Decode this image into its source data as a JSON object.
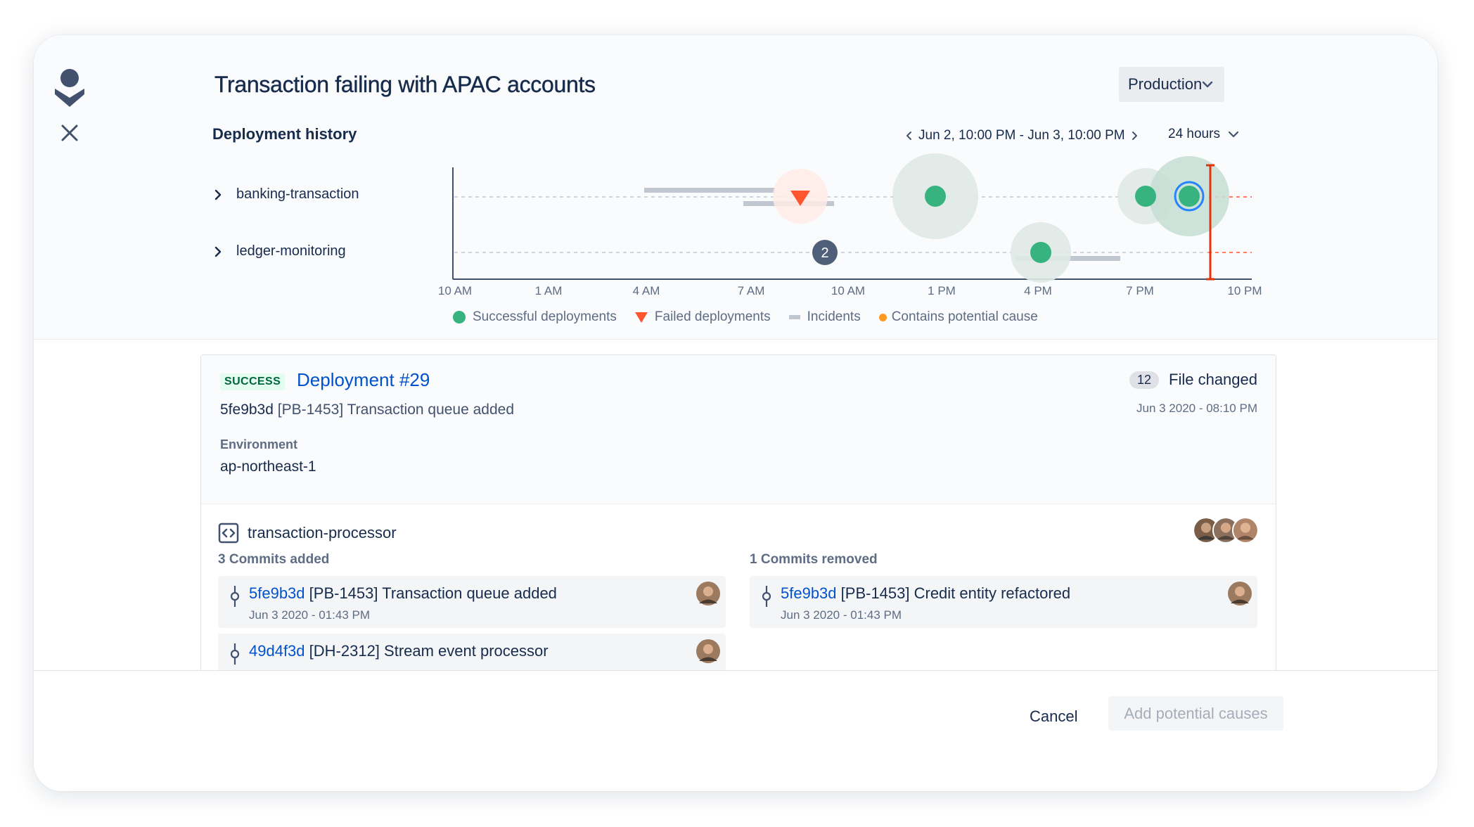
{
  "modal": {
    "title": "Transaction failing with APAC accounts",
    "environment_selected": "Production"
  },
  "deployment_history": {
    "label": "Deployment history",
    "range_text": "Jun 2, 10:00 PM - Jun 3, 10:00 PM",
    "duration": "24 hours",
    "services": [
      "banking-transaction",
      "ledger-monitoring"
    ],
    "time_ticks": [
      "10 AM",
      "1 AM",
      "4 AM",
      "7 AM",
      "10 AM",
      "1 PM",
      "4 PM",
      "7 PM",
      "10 PM"
    ],
    "grouped_count": "2",
    "legend": {
      "successful": "Successful deployments",
      "failed": "Failed deployments",
      "incidents": "Incidents",
      "potential_cause": "Contains potential cause"
    }
  },
  "deployment": {
    "status": "SUCCESS",
    "title": "Deployment #29",
    "commit_hash": "5fe9b3d",
    "commit_message": "[PB-1453] Transaction queue added",
    "files_count": "12",
    "files_label": "File changed",
    "date": "Jun 3 2020 - 08:10 PM",
    "environment_label": "Environment",
    "environment_value": "ap-northeast-1"
  },
  "repo": {
    "name": "transaction-processor",
    "commits_added_label": "3 Commits added",
    "commits_removed_label": "1 Commits removed",
    "commits_added": [
      {
        "hash": "5fe9b3d",
        "message": "[PB-1453] Transaction queue added",
        "date": "Jun 3 2020 - 01:43 PM"
      },
      {
        "hash": "49d4f3d",
        "message": "[DH-2312] Stream event processor",
        "date": ""
      }
    ],
    "commits_removed": [
      {
        "hash": "5fe9b3d",
        "message": "[PB-1453] Credit entity refactored",
        "date": "Jun 3 2020 - 01:43 PM"
      }
    ]
  },
  "footer": {
    "cancel_label": "Cancel",
    "add_label": "Add potential causes"
  },
  "colors": {
    "success": "#36b37e",
    "failed": "#ff5630",
    "incident": "#c1c7d0",
    "potential_cause": "#ff991f",
    "link": "#0052cc",
    "cursor_line": "#de350b"
  }
}
